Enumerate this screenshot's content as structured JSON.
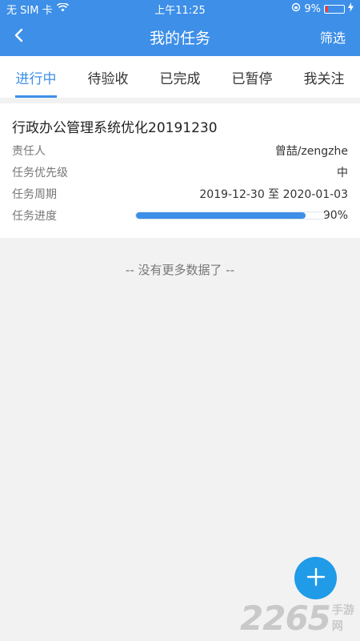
{
  "status_bar": {
    "carrier": "无 SIM 卡",
    "time": "上午11:25",
    "battery": "9%"
  },
  "nav": {
    "title": "我的任务",
    "filter_label": "筛选"
  },
  "tabs": [
    {
      "label": "进行中",
      "active": true
    },
    {
      "label": "待验收"
    },
    {
      "label": "已完成"
    },
    {
      "label": "已暂停"
    },
    {
      "label": "我关注"
    }
  ],
  "task": {
    "title": "行政办公管理系统优化20191230",
    "owner_label": "责任人",
    "owner_value": "曾喆/zengzhe",
    "priority_label": "任务优先级",
    "priority_value": "中",
    "period_label": "任务周期",
    "period_value": "2019-12-30 至 2020-01-03",
    "progress_label": "任务进度",
    "progress_value": 0.9,
    "progress_text": "90%"
  },
  "list_footer": "-- 没有更多数据了 --",
  "watermark": {
    "number": "2265",
    "text": "手游网"
  },
  "colors": {
    "primary": "#3d8fe8",
    "fab": "#1f9be8"
  }
}
